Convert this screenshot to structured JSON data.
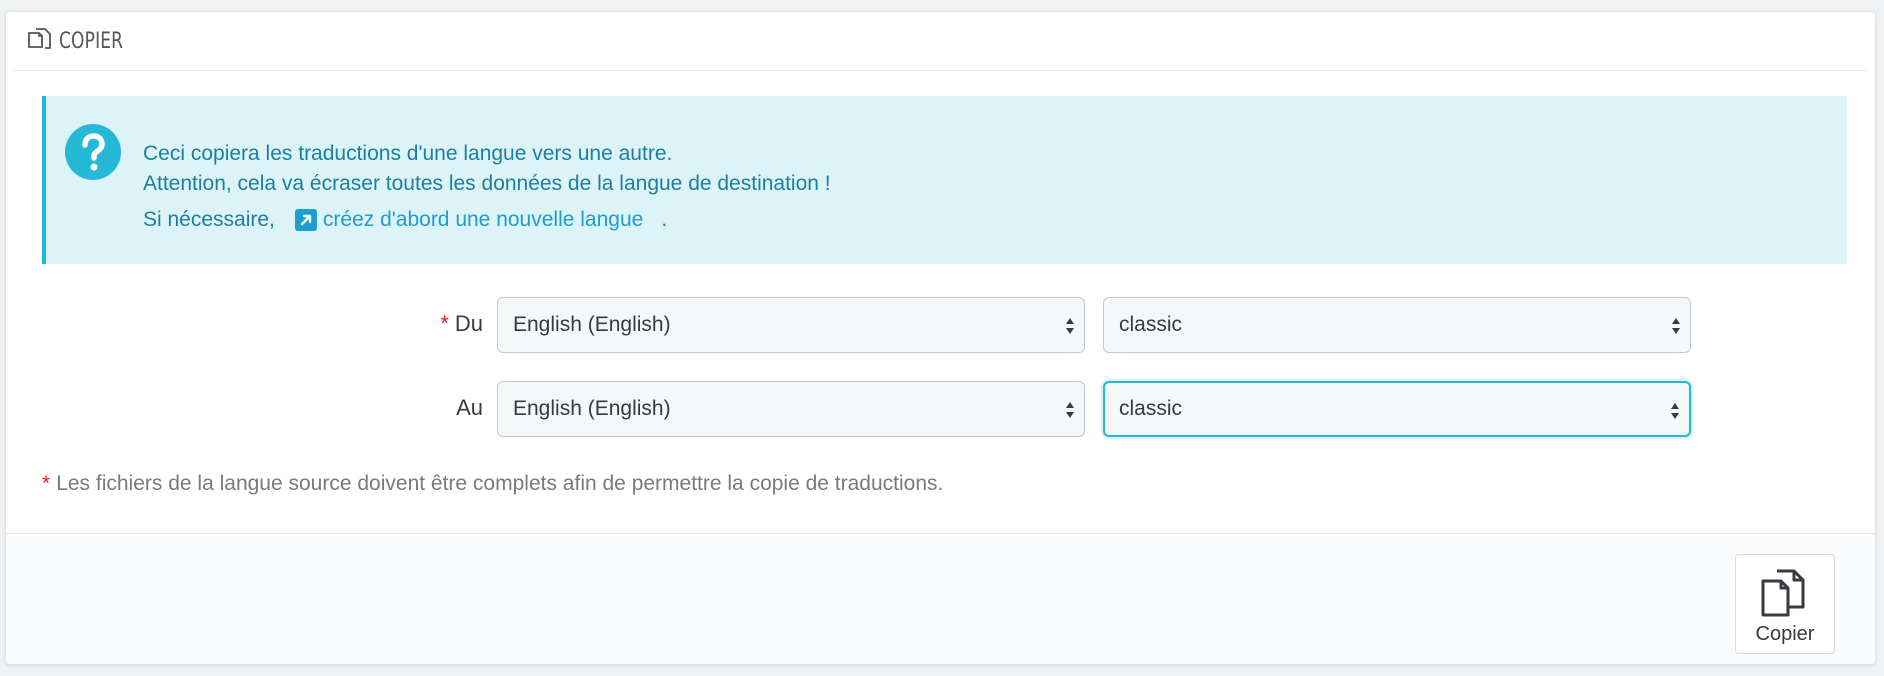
{
  "panel": {
    "title": "COPIER",
    "title_icon": "copy-icon"
  },
  "alert": {
    "icon": "question-circle-icon",
    "line1": "Ceci copiera les traductions d'une langue vers une autre.",
    "line2": "Attention, cela va écraser toutes les données de la langue de destination !",
    "line3_prefix": "Si nécessaire,",
    "link_icon": "external-link-icon",
    "link_text": "créez d'abord une nouvelle langue",
    "line3_suffix": ".",
    "color_bg": "#dcf3f8",
    "color_accent": "#25b9d7"
  },
  "form": {
    "from": {
      "required_mark": "*",
      "label": "Du",
      "language_value": "English (English)",
      "theme_value": "classic"
    },
    "to": {
      "label": "Au",
      "language_value": "English (English)",
      "theme_value": "classic"
    },
    "note_mark": "*",
    "note": "Les fichiers de la langue source doivent être complets afin de permettre la copie de traductions."
  },
  "footer": {
    "copy_button_label": "Copier",
    "copy_button_icon": "copy-icon"
  }
}
